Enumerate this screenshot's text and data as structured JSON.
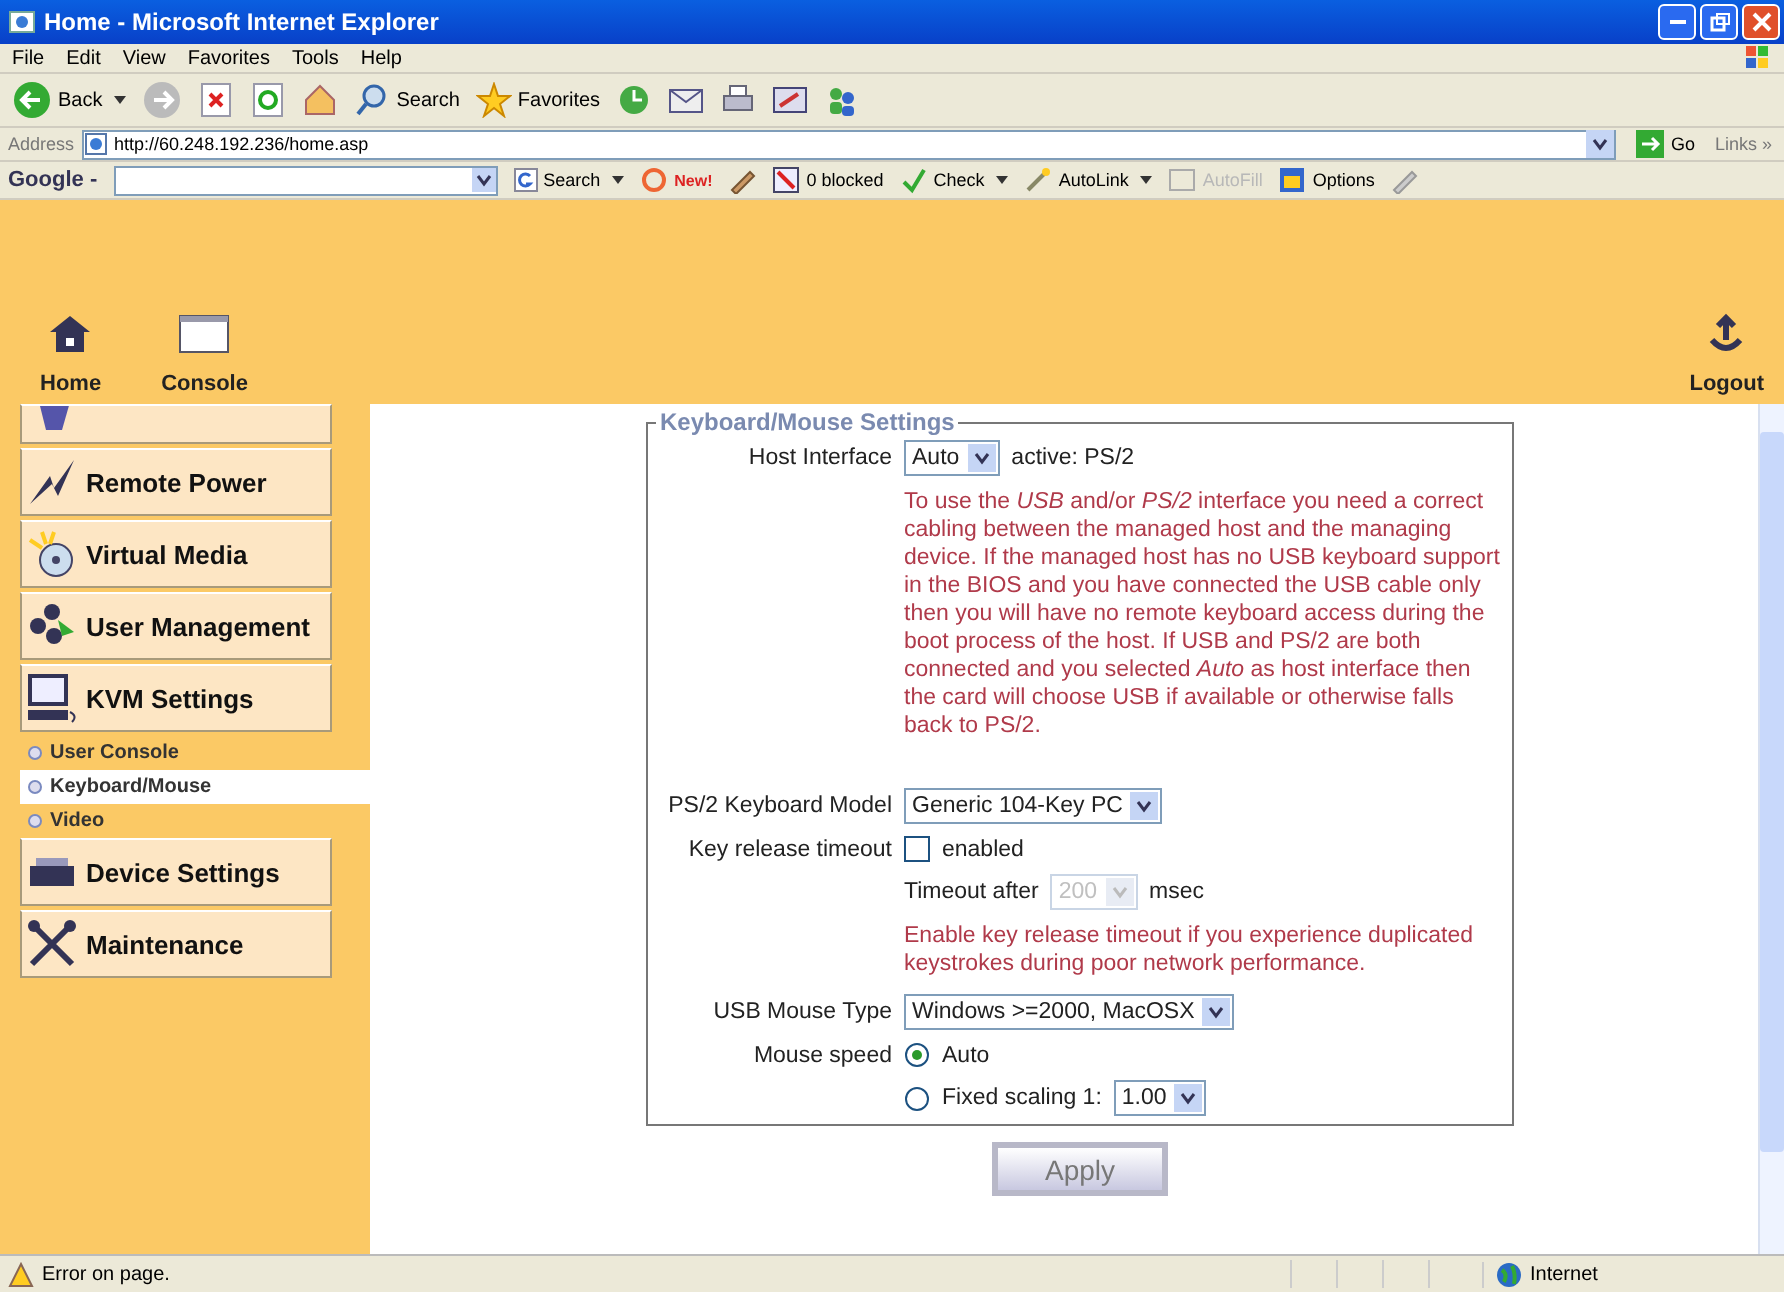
{
  "window": {
    "title": "Home - Microsoft Internet Explorer"
  },
  "menu_bar": [
    "File",
    "Edit",
    "View",
    "Favorites",
    "Tools",
    "Help"
  ],
  "toolbar": {
    "back": "Back",
    "search": "Search",
    "favorites": "Favorites"
  },
  "address_bar": {
    "label": "Address",
    "url": "http://60.248.192.236/home.asp",
    "go": "Go",
    "links": "Links »"
  },
  "google_bar": {
    "logo": "Google -",
    "search": "Search",
    "new_badge": "New!",
    "blocked": "0 blocked",
    "check": "Check",
    "autolink": "AutoLink",
    "autofill": "AutoFill",
    "autofill_disabled": true,
    "options": "Options"
  },
  "header": {
    "nav": [
      {
        "kind": "home",
        "label": "Home"
      },
      {
        "kind": "console",
        "label": "Console"
      }
    ],
    "logout": "Logout"
  },
  "sidebar": {
    "items": [
      {
        "kind": "cut"
      },
      {
        "kind": "button",
        "label": "Remote Power"
      },
      {
        "kind": "button",
        "label": "Virtual Media"
      },
      {
        "kind": "button",
        "label": "User Management"
      },
      {
        "kind": "button",
        "label": "KVM Settings"
      },
      {
        "kind": "sub",
        "label": "User Console",
        "selected": false
      },
      {
        "kind": "sub",
        "label": "Keyboard/Mouse",
        "selected": true
      },
      {
        "kind": "sub",
        "label": "Video",
        "selected": false
      },
      {
        "kind": "button",
        "label": "Device Settings"
      },
      {
        "kind": "button",
        "label": "Maintenance"
      }
    ]
  },
  "form": {
    "legend": "Keyboard/Mouse Settings",
    "host_interface": {
      "label": "Host Interface",
      "value": "Auto",
      "active": "active: PS/2"
    },
    "host_note": "To use the *USB* and/or *PS/2* interface you need a correct cabling between the managed host and the managing device. If the managed host has no USB keyboard support in the BIOS and you have connected the USB cable only then you will have no remote keyboard access during the boot process of the host. If USB and PS/2 are both connected and you selected *Auto* as host interface then the card will choose USB if available or otherwise falls back to PS/2.",
    "keyboard_model": {
      "label": "PS/2 Keyboard Model",
      "value": "Generic 104-Key PC"
    },
    "key_release": {
      "label": "Key release timeout",
      "option": "enabled",
      "checked": false
    },
    "timeout": {
      "label": "Timeout after",
      "value": "200",
      "unit": "msec",
      "disabled": true
    },
    "timeout_note": "Enable key release timeout if you experience duplicated keystrokes during poor network performance.",
    "mouse_type": {
      "label": "USB Mouse Type",
      "value": "Windows >=2000, MacOSX"
    },
    "mouse_speed": {
      "label": "Mouse speed",
      "options": [
        {
          "label": "Auto",
          "selected": true
        },
        {
          "label": "Fixed scaling 1:",
          "selected": false,
          "value": "1.00"
        }
      ]
    },
    "apply": "Apply"
  },
  "status_bar": {
    "message": "Error on page.",
    "zone": "Internet"
  }
}
